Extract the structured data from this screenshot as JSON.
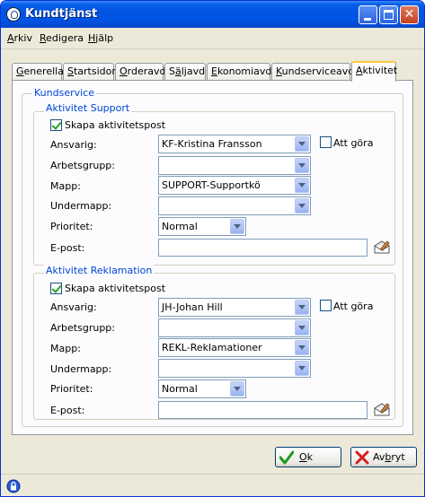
{
  "window": {
    "title": "Kundtjänst"
  },
  "menu": [
    {
      "u": "A",
      "rest": "rkiv"
    },
    {
      "u": "R",
      "rest": "edigera"
    },
    {
      "u": "H",
      "rest": "jälp"
    }
  ],
  "tabs": [
    {
      "u": "G",
      "rest": "enerella"
    },
    {
      "u": "S",
      "rest": "tartsidor"
    },
    {
      "u": "O",
      "rest": "rderavd"
    },
    {
      "pre": "S",
      "u": "ä",
      "rest": "ljavd"
    },
    {
      "u": "E",
      "rest": "konomiavd"
    },
    {
      "u": "K",
      "rest": "undserviceavd"
    },
    {
      "u": "A",
      "rest": "ktivitet"
    }
  ],
  "kundservice": {
    "label": "Kundservice",
    "support": {
      "label": "Aktivitet Support",
      "skapa_label": "Skapa aktivitetspost",
      "skapa_checked": true,
      "ansvarig_label": "Ansvarig:",
      "ansvarig_value": "KF-Kristina Fransson",
      "att_gora_label": "Att göra",
      "att_gora_checked": false,
      "arbetsgrupp_label": "Arbetsgrupp:",
      "arbetsgrupp_value": "",
      "mapp_label": "Mapp:",
      "mapp_value": "SUPPORT-Supportkö",
      "undermapp_label": "Undermapp:",
      "undermapp_value": "",
      "prioritet_label": "Prioritet:",
      "prioritet_value": "Normal",
      "epost_label": "E-post:",
      "epost_value": ""
    },
    "reklamation": {
      "label": "Aktivitet Reklamation",
      "skapa_label": "Skapa aktivitetspost",
      "skapa_checked": true,
      "ansvarig_label": "Ansvarig:",
      "ansvarig_value": "JH-Johan Hill",
      "att_gora_label": "Att göra",
      "att_gora_checked": false,
      "arbetsgrupp_label": "Arbetsgrupp:",
      "arbetsgrupp_value": "",
      "mapp_label": "Mapp:",
      "mapp_value": "REKL-Reklamationer",
      "undermapp_label": "Undermapp:",
      "undermapp_value": "",
      "prioritet_label": "Prioritet:",
      "prioritet_value": "Normal",
      "epost_label": "E-post:",
      "epost_value": ""
    }
  },
  "buttons": {
    "ok": {
      "u": "O",
      "rest": "k"
    },
    "cancel": {
      "pre": "Av",
      "u": "b",
      "rest": "ryt"
    }
  },
  "icons": {
    "title": "app-icon",
    "ok": "green-check-icon",
    "cancel": "red-x-icon",
    "email": "envelope-pen-icon",
    "status": "lock-icon"
  }
}
